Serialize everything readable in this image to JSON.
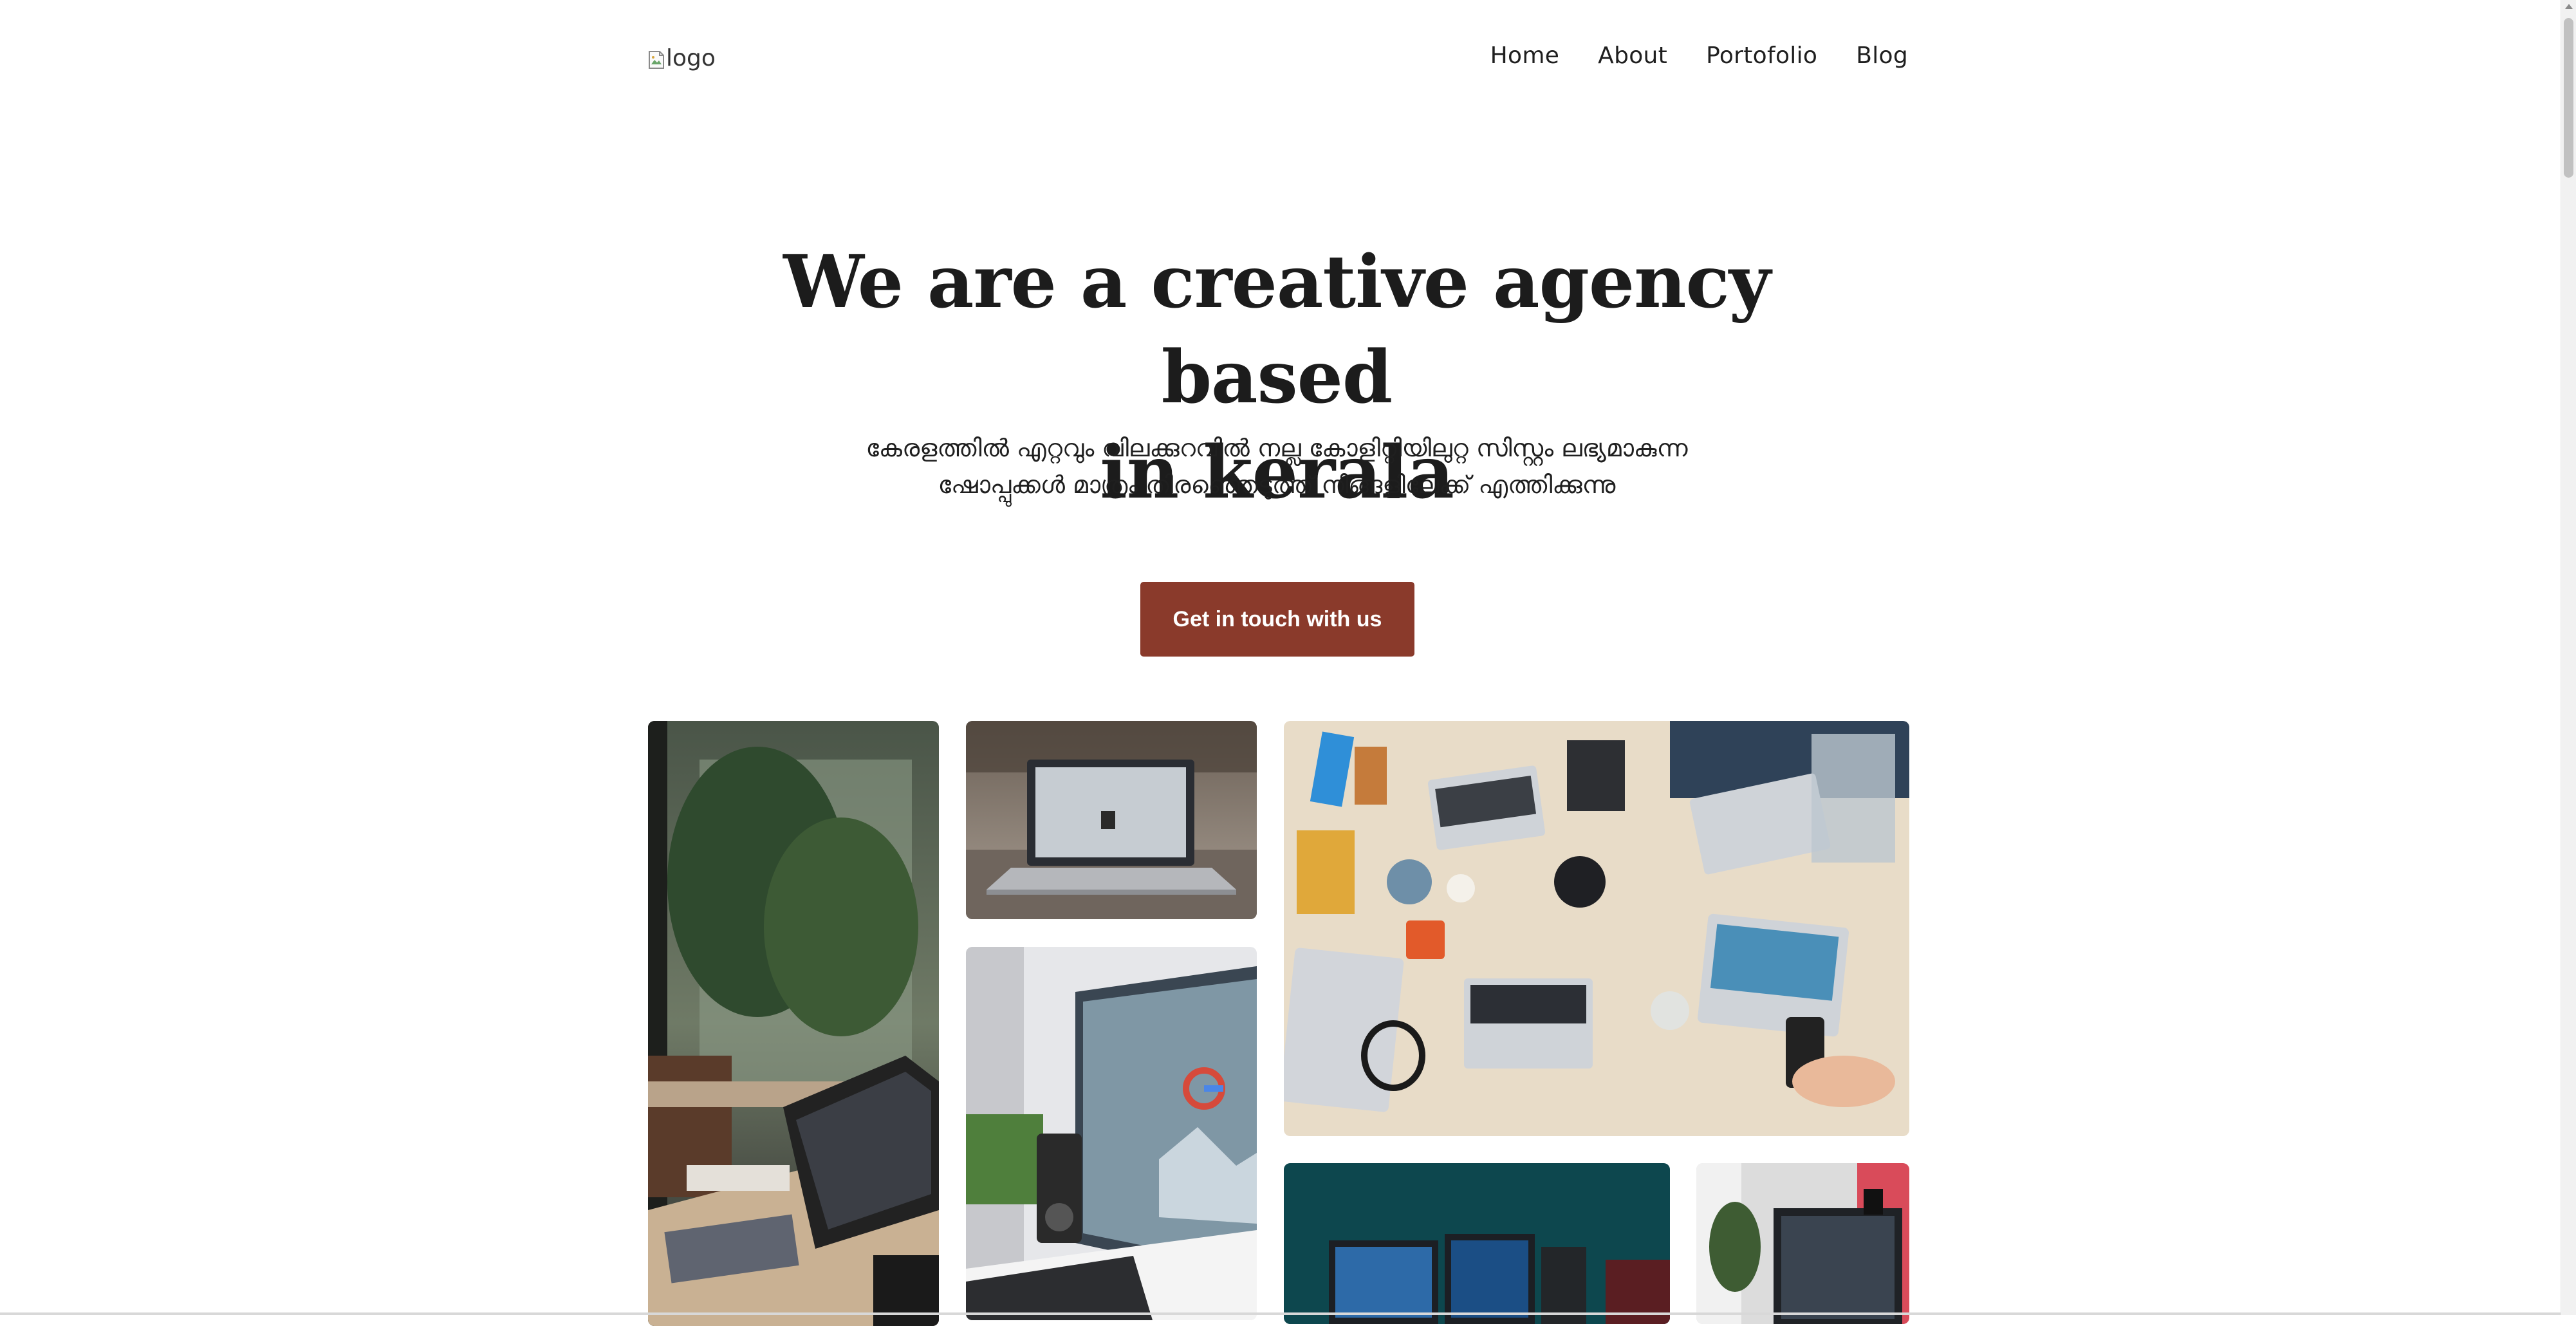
{
  "header": {
    "logo_alt": "logo",
    "nav": [
      {
        "label": "Home"
      },
      {
        "label": "About"
      },
      {
        "label": "Portofolio"
      },
      {
        "label": "Blog"
      }
    ]
  },
  "hero": {
    "title_line1": "We are a creative agency based",
    "title_line2": "in kerala",
    "subtitle_line1": "കേരളത്തിൽ എറ്റവും വിലക്കുറവിൽ നല്ല കോളിറ്റിയിലുറ്റ സിസ്റ്റം ലഭ്യമാകുന്ന",
    "subtitle_line2": "ഷോപ്പുക്കൾ മാത്രം തിരഞ്ഞെടുത്ത് നിങ്ങളിലേക്ക് എത്തിക്കുന്നു",
    "cta_label": "Get in touch with us",
    "cta_color": "#8a3a2b"
  },
  "gallery": {
    "images": [
      {
        "icon": "desk-plants-laptop-photo"
      },
      {
        "icon": "laptop-on-table-photo"
      },
      {
        "icon": "monitor-google-photo"
      },
      {
        "icon": "team-laptops-overhead-photo"
      },
      {
        "icon": "teal-gaming-setup-photo"
      },
      {
        "icon": "monitor-red-light-photo"
      }
    ]
  }
}
